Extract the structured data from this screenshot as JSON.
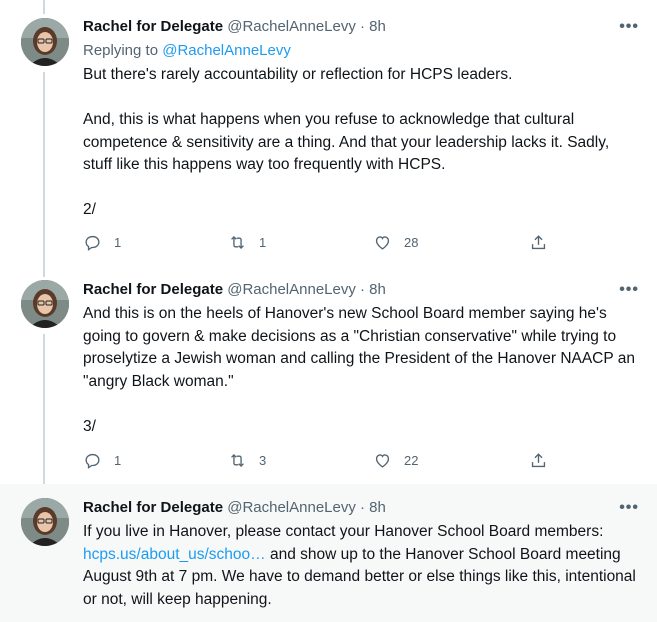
{
  "tweets": [
    {
      "author_name": "Rachel for Delegate",
      "handle_time": "@RachelAnneLevy · 8h",
      "more_glyph": "•••",
      "reply_prefix": "Replying to ",
      "reply_mention": "@RachelAnneLevy",
      "body": {
        "line1": "But there's rarely accountability or reflection for HCPS leaders.",
        "line2": "And, this is what happens when you refuse to acknowledge that cultural competence & sensitivity are a thing. And that your leadership lacks it. Sadly, stuff like this happens way too frequently with HCPS.",
        "line3": "2/"
      },
      "replies": "1",
      "retweets": "1",
      "likes": "28"
    },
    {
      "author_name": "Rachel for Delegate",
      "handle_time": "@RachelAnneLevy · 8h",
      "more_glyph": "•••",
      "body": {
        "line1": "And this is on the heels of Hanover's new School Board member saying he's going to govern & make decisions as a \"Christian conservative\" while trying to proselytize a Jewish woman and calling the President of the Hanover NAACP an \"angry Black woman.\"",
        "line2": "3/"
      },
      "replies": "1",
      "retweets": "3",
      "likes": "22"
    },
    {
      "author_name": "Rachel for Delegate",
      "handle_time": "@RachelAnneLevy · 8h",
      "more_glyph": "•••",
      "body": {
        "before_link": "If you live in Hanover, please contact your Hanover School Board members: ",
        "link": "hcps.us/about_us/schoo…",
        "after_link": " and show up to the Hanover School Board meeting August 9th at 7 pm. We have to demand better or else things like this, intentional or not, will keep happening."
      }
    }
  ],
  "icons": {
    "reply": "reply-icon",
    "retweet": "retweet-icon",
    "like": "heart-icon",
    "share": "share-icon",
    "more": "more-options-icon"
  },
  "colors": {
    "link": "#1d9bf0",
    "secondary_text": "#536471",
    "thread_line": "#cfd9de",
    "highlight_bg": "#f7f9f9"
  }
}
